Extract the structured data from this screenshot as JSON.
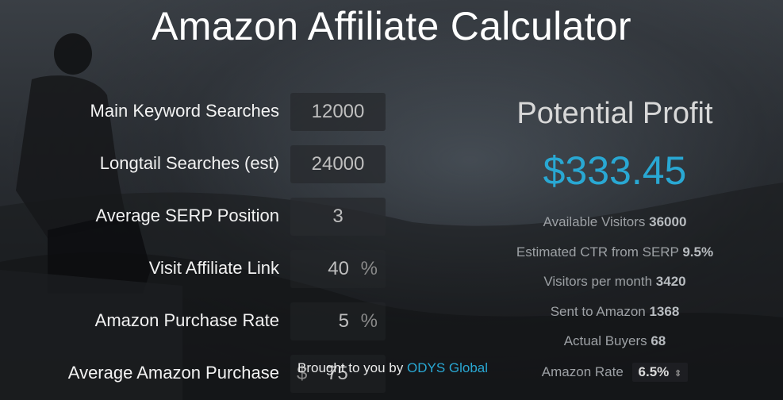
{
  "title": "Amazon Affiliate Calculator",
  "inputs": [
    {
      "label": "Main Keyword Searches",
      "value": "12000",
      "unit": ""
    },
    {
      "label": "Longtail Searches (est)",
      "value": "24000",
      "unit": ""
    },
    {
      "label": "Average SERP Position",
      "value": "3",
      "unit": ""
    },
    {
      "label": "Visit Affiliate Link",
      "value": "40",
      "unit": "%"
    },
    {
      "label": "Amazon Purchase Rate",
      "value": "5",
      "unit": "%"
    },
    {
      "label": "Average Amazon Purchase",
      "value": "75",
      "unit": "$"
    }
  ],
  "results": {
    "heading": "Potential Profit",
    "profit": "$333.45",
    "stats": [
      {
        "label": "Available Visitors",
        "value": "36000"
      },
      {
        "label": "Estimated CTR from SERP",
        "value": "9.5%"
      },
      {
        "label": "Visitors per month",
        "value": "3420"
      },
      {
        "label": "Sent to Amazon",
        "value": "1368"
      },
      {
        "label": "Actual Buyers",
        "value": "68"
      }
    ],
    "rate_label": "Amazon Rate",
    "rate_value": "6.5%"
  },
  "credit": {
    "text": "Brought to you by",
    "link": "ODYS Global"
  },
  "colors": {
    "accent": "#29a8d3",
    "input_bg": "#2a2c30"
  }
}
